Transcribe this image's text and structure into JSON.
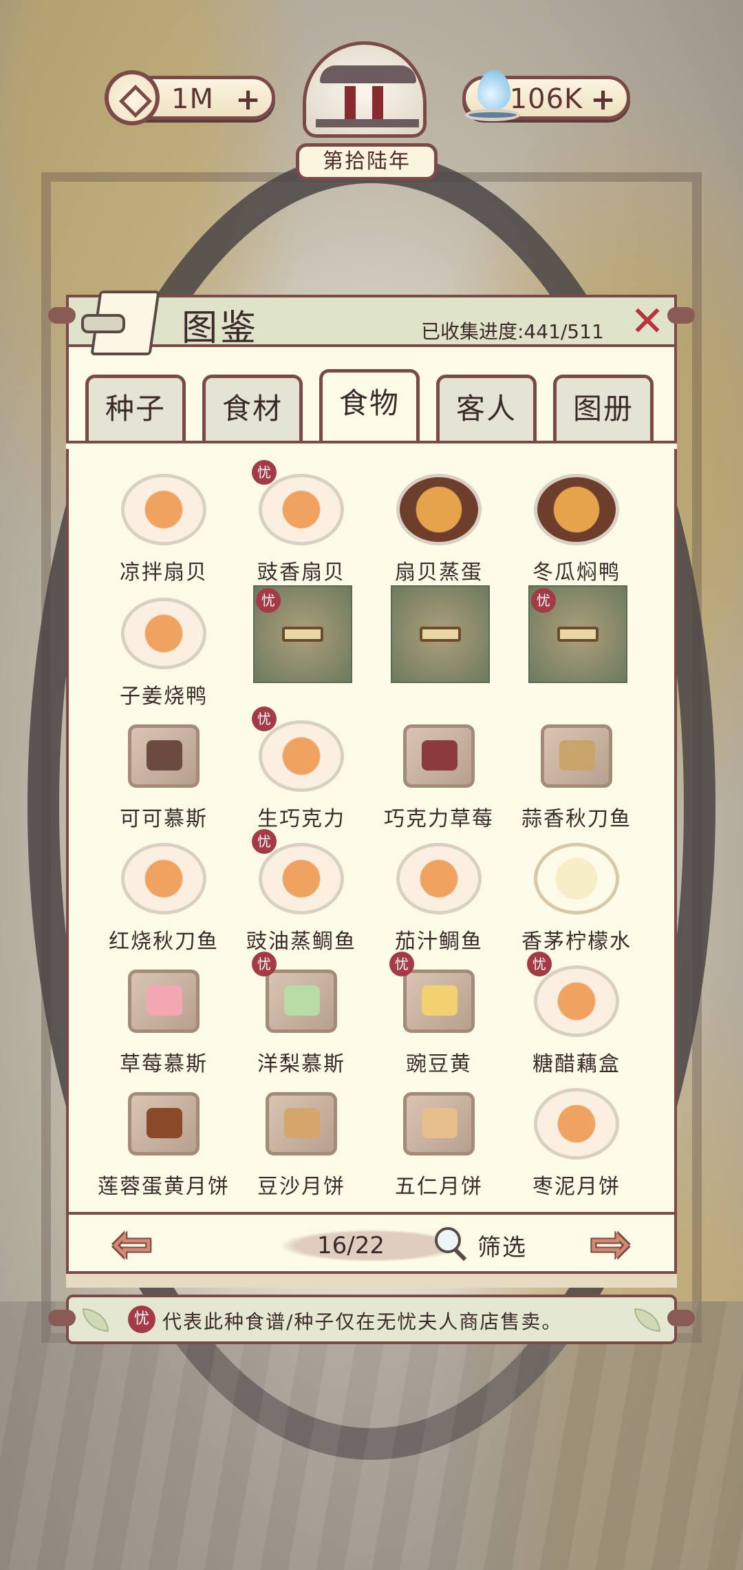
{
  "top_bar": {
    "coins": "1M",
    "water": "106K",
    "year": "第拾陆年",
    "plus_symbol": "+"
  },
  "panel": {
    "title": "图鉴",
    "progress_label": "已收集进度:441/511",
    "close_symbol": "✕"
  },
  "tabs": [
    {
      "label": "种子",
      "active": false
    },
    {
      "label": "食材",
      "active": false
    },
    {
      "label": "食物",
      "active": true
    },
    {
      "label": "客人",
      "active": false
    },
    {
      "label": "图册",
      "active": false
    }
  ],
  "badge_char": "忧",
  "items": [
    {
      "name": "凉拌扇贝",
      "style": "plate",
      "badge": false,
      "locked": false
    },
    {
      "name": "豉香扇贝",
      "style": "plate",
      "badge": true,
      "locked": false
    },
    {
      "name": "扇贝蒸蛋",
      "style": "bowl",
      "badge": false,
      "locked": false
    },
    {
      "name": "冬瓜焖鸭",
      "style": "bowl",
      "badge": false,
      "locked": false
    },
    {
      "name": "子姜烧鸭",
      "style": "plate",
      "badge": false,
      "locked": false
    },
    {
      "name": "",
      "style": "locked",
      "badge": true,
      "locked": true
    },
    {
      "name": "",
      "style": "locked",
      "badge": false,
      "locked": true
    },
    {
      "name": "",
      "style": "locked",
      "badge": true,
      "locked": true
    },
    {
      "name": "可可慕斯",
      "style": "board",
      "fill": "#6b4a3f",
      "badge": false,
      "locked": false
    },
    {
      "name": "生巧克力",
      "style": "plate",
      "badge": true,
      "locked": false
    },
    {
      "name": "巧克力草莓",
      "style": "board",
      "fill": "#8b3b3b",
      "badge": false,
      "locked": false
    },
    {
      "name": "蒜香秋刀鱼",
      "style": "board",
      "fill": "#c9a46a",
      "badge": false,
      "locked": false
    },
    {
      "name": "红烧秋刀鱼",
      "style": "plate",
      "badge": false,
      "locked": false
    },
    {
      "name": "豉油蒸鲷鱼",
      "style": "plate",
      "badge": true,
      "locked": false
    },
    {
      "name": "茄汁鲷鱼",
      "style": "plate",
      "badge": false,
      "locked": false
    },
    {
      "name": "香茅柠檬水",
      "style": "glass",
      "badge": false,
      "locked": false
    },
    {
      "name": "草莓慕斯",
      "style": "board",
      "fill": "#f2a7b3",
      "badge": false,
      "locked": false
    },
    {
      "name": "洋梨慕斯",
      "style": "board",
      "fill": "#b8dca6",
      "badge": true,
      "locked": false
    },
    {
      "name": "豌豆黄",
      "style": "board",
      "fill": "#f3d070",
      "badge": true,
      "locked": false
    },
    {
      "name": "糖醋藕盒",
      "style": "plate",
      "badge": true,
      "locked": false
    },
    {
      "name": "莲蓉蛋黄月饼",
      "style": "board",
      "fill": "#8a4a2a",
      "badge": false,
      "locked": false
    },
    {
      "name": "豆沙月饼",
      "style": "board",
      "fill": "#d7a66a",
      "badge": false,
      "locked": false
    },
    {
      "name": "五仁月饼",
      "style": "board",
      "fill": "#e7bf8a",
      "badge": false,
      "locked": false
    },
    {
      "name": "枣泥月饼",
      "style": "plate",
      "badge": false,
      "locked": false
    }
  ],
  "pager": {
    "prev_symbol": "⇦",
    "next_symbol": "⇨",
    "page": "16/22",
    "filter_label": "筛选"
  },
  "footer": {
    "note": "代表此种食谱/种子仅在无忧夫人商店售卖。"
  },
  "colors": {
    "accent": "#7a4a48",
    "badge": "#a33a46",
    "panel": "#fbfbe8"
  }
}
